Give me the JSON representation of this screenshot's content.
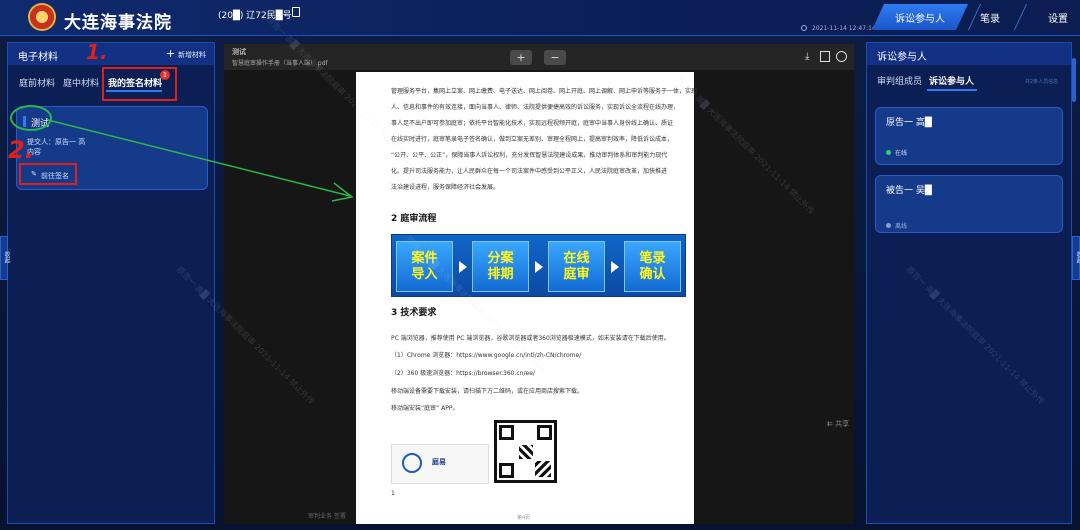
{
  "header": {
    "app_title": "大连海事法院",
    "case_info": "(20█) 辽72民█号",
    "datetime": "2021-11-14 12:47:14",
    "nav": [
      "诉讼参与人",
      "笔录",
      "设置"
    ]
  },
  "left_panel": {
    "title": "电子材料",
    "add_label": "新增材料",
    "tabs": [
      "庭前材料",
      "庭中材料",
      "我的签名材料"
    ],
    "badge": "1",
    "card": {
      "name": "测试",
      "submitter_label": "提交人：原告一 高",
      "content_label": "内容",
      "sign_button": "前往签名"
    },
    "handle": "收起"
  },
  "viewer": {
    "doc_title": "测试",
    "doc_filename": "智慧庭审操作手册（当事人端）.pdf",
    "share_label": "共享",
    "watermark_caption": "审判业务 签署",
    "page_number": "第4页"
  },
  "document": {
    "para1": [
      "管理服务平台，集网上立案、网上缴费、电子送达、网上阅卷、网上开庭、网上调解、网上申诉等服务于一体，实现",
      "人、信息和事件的有效连接，面向当事人、律师、法院提供便捷高效的诉讼服务，实现诉讼全流程在线办理，",
      "事人足不出户即可参加庭审；依托平台智能化技术，实现远程视频开庭，庭审中当事人身份线上确认、质证",
      "在线实时进行，庭审笔录电子签名确认，做到立案无差别、审理全程网上，提高审判效率，降低诉讼成本，",
      "“公开、公平、公正”，保障当事人诉讼权利，充分发挥智慧法院建设成果，推动审判体系和审判能力现代",
      "化。提升司法服务能力，让人民群众在每一个司法案件中感受到公平正义，人民法院庭审改革，加快推进",
      "法治建设进程，服务保障经济社会发展。"
    ],
    "section2_title": "2  庭审流程",
    "steps": [
      [
        "案件",
        "导入"
      ],
      [
        "分案",
        "排期"
      ],
      [
        "在线",
        "庭审"
      ],
      [
        "笔录",
        "确认"
      ]
    ],
    "section3_title": "3  技术要求",
    "tech_lines": [
      "PC 端浏览器，推荐使用 PC 端浏览器，谷歌浏览器或者360浏览器极速模式，如未安装请在下载后使用。",
      "（1）Chrome 浏览器：https://www.google.cn/intl/zh-CN/chrome/",
      "（2）360 极速浏览器：https://browser.360.cn/ee/",
      "移动端设备需要下载安装，请扫描下方二维码，或在应用商店搜索下载。",
      "移动端安装“庭审” APP。"
    ],
    "app_name": "庭易",
    "foot_marker": "1"
  },
  "right_panel": {
    "title": "诉讼参与人",
    "tabs": [
      "审判组成员",
      "诉讼参与人"
    ],
    "hint": "共2条人员信息",
    "participants": [
      {
        "name": "原告一 高█",
        "status": "在线",
        "status_color": "#24d36a"
      },
      {
        "name": "被告一 吴█",
        "status": "离线",
        "status_color": "#8aa0cc"
      }
    ],
    "handle": "收起"
  },
  "annotations": {
    "mark1": "1.",
    "mark2": "2."
  },
  "watermark": "原告一 高█ 大连海事法院庭审 2021-11-14 禁止外传"
}
